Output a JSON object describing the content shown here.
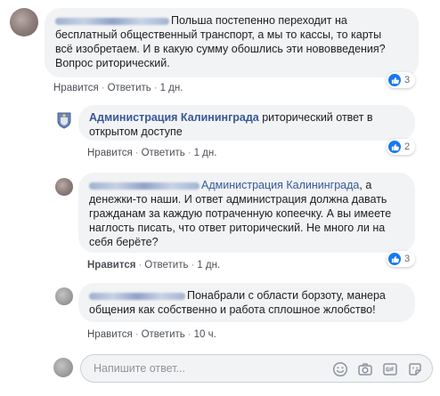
{
  "comments": [
    {
      "text": "Польша постепенно переходит на бесплатный общественный транспорт, а мы то кассы, то карты всё изобретаем. И в какую сумму обошлись эти нововведения? Вопрос риторический.",
      "text_lines": [
        "Польша постепенно переходит на",
        "бесплатный общественный транспорт, а мы то кассы, то карты",
        "всё изобретаем. И в какую сумму обошлись эти нововведения?",
        "Вопрос риторический."
      ],
      "like": "Нравится",
      "reply": "Ответить",
      "time": "1 дн.",
      "reactions": "3"
    },
    {
      "author": "Администрация Калининграда",
      "text_lines": [
        "риторический ответ в",
        "открытом доступе"
      ],
      "like": "Нравится",
      "reply": "Ответить",
      "time": "1 дн.",
      "reactions": "2"
    },
    {
      "mention": "Администрация Калининграда",
      "text_lines": [
        ", а",
        "денежки-то наши. И ответ администрация должна давать",
        "гражданам за каждую потраченную копеечку. А вы имеете",
        "наглость писать, что ответ риторический. Не много ли на",
        "себя берёте?"
      ],
      "like": "Нравится",
      "reply": "Ответить",
      "time": "1 дн.",
      "reactions": "3"
    },
    {
      "text_lines": [
        "Понабрали с области борзоту, манера",
        "общения как собственно и работа сплошное жлобство!"
      ],
      "like": "Нравится",
      "reply": "Ответить",
      "time": "10 ч."
    }
  ],
  "reply_input": {
    "placeholder": "Напишите ответ..."
  },
  "separator": "·",
  "icons": [
    "like-icon",
    "emoji-icon",
    "camera-icon",
    "gif-icon",
    "sticker-icon",
    "admin-logo"
  ],
  "colors": {
    "link": "#385898",
    "like_blue": "#1877f2",
    "bubble": "#f2f3f5",
    "meta": "#90949c"
  }
}
